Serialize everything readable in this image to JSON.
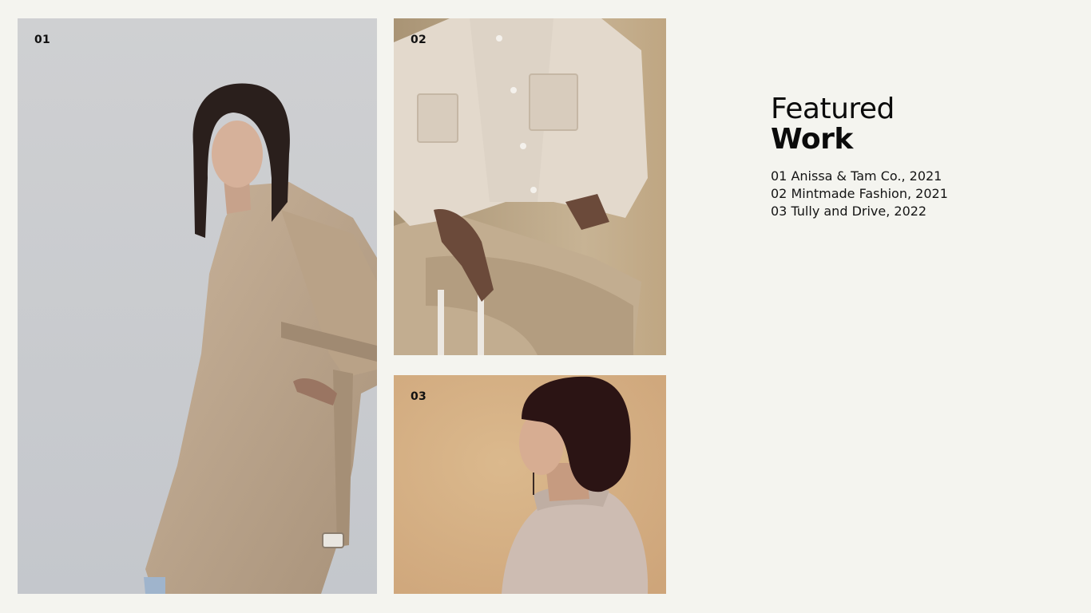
{
  "photos": [
    {
      "number": "01",
      "subject": "woman in beige trench coat, looking down, grey backdrop"
    },
    {
      "number": "02",
      "subject": "seated person in cream overshirt and khaki trousers"
    },
    {
      "number": "03",
      "subject": "woman with bob haircut in knit sweater, profile, tan backdrop"
    }
  ],
  "featured": {
    "title_line1": "Featured",
    "title_line2": "Work",
    "projects": [
      "01 Anissa & Tam Co., 2021",
      "02 Mintmade Fashion, 2021",
      "03 Tully and Drive, 2022"
    ]
  },
  "colors": {
    "page_background": "#f4f4ef",
    "text": "#0b0b0b"
  }
}
